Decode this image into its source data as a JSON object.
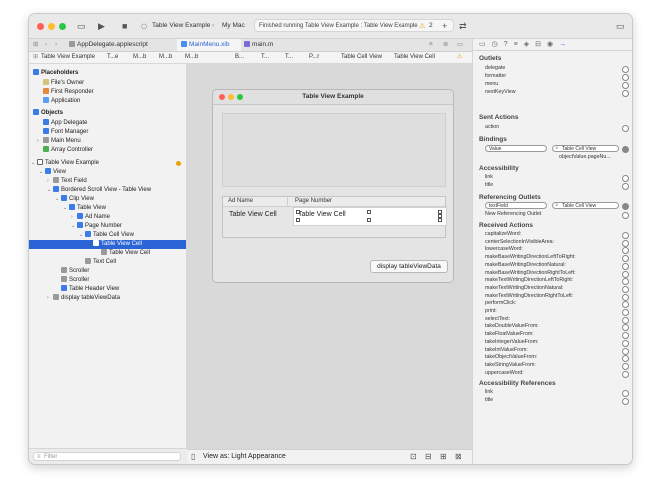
{
  "toolbar": {
    "scheme_target": "Table View Example",
    "scheme_device": "My Mac",
    "status": "Finished running Table View Example : Table View Example",
    "warning_count": "2"
  },
  "tabs": [
    {
      "label": "AppDelegate.applescript",
      "active": false
    },
    {
      "label": "MainMenu.xib",
      "active": true
    },
    {
      "label": "main.m",
      "active": false
    }
  ],
  "jumpbar": [
    "T...e)",
    "T...e",
    "M...b",
    "M...b",
    "B...",
    "T...",
    "T...",
    "P...r",
    "Table Cell View",
    "Table View Cell"
  ],
  "navigator": {
    "placeholders_title": "Placeholders",
    "placeholders": [
      "File's Owner",
      "First Responder",
      "Application"
    ],
    "objects_title": "Objects",
    "objects": [
      "App Delegate",
      "Font Manager",
      "Main Menu",
      "Array Controller"
    ],
    "window_title": "Table View Example",
    "tree": [
      {
        "label": "View",
        "indent": 1,
        "disclosure": "open"
      },
      {
        "label": "Text Field",
        "indent": 2,
        "disclosure": "closed"
      },
      {
        "label": "Bordered Scroll View - Table View",
        "indent": 2,
        "disclosure": "open"
      },
      {
        "label": "Clip View",
        "indent": 3,
        "disclosure": "open"
      },
      {
        "label": "Table View",
        "indent": 4,
        "disclosure": "open"
      },
      {
        "label": "Ad Name",
        "indent": 5,
        "disclosure": "closed"
      },
      {
        "label": "Page Number",
        "indent": 5,
        "disclosure": "open"
      },
      {
        "label": "Table Cell View",
        "indent": 6,
        "disclosure": "open"
      },
      {
        "label": "Table View Cell",
        "indent": 7,
        "disclosure": "open",
        "selected": true
      },
      {
        "label": "Table View Cell",
        "indent": 8,
        "disclosure": "none"
      },
      {
        "label": "Text Cell",
        "indent": 6,
        "disclosure": "none"
      },
      {
        "label": "Scroller",
        "indent": 3,
        "disclosure": "none"
      },
      {
        "label": "Scroller",
        "indent": 3,
        "disclosure": "none"
      },
      {
        "label": "Table Header View",
        "indent": 3,
        "disclosure": "none"
      },
      {
        "label": "display tableViewData",
        "indent": 2,
        "disclosure": "closed"
      }
    ],
    "filter_placeholder": "Filter"
  },
  "canvas": {
    "window_title": "Table View Example",
    "col1_header": "Ad Name",
    "col2_header": "Page Number",
    "cell1": "Table View Cell",
    "cell2": "Table View Cell",
    "button_label": "display tableViewData",
    "view_as": "View as: Light Appearance"
  },
  "inspector": {
    "outlets_title": "Outlets",
    "outlets": [
      "delegate",
      "formatter",
      "menu",
      "nextKeyView"
    ],
    "sent_actions_title": "Sent Actions",
    "sent_actions": [
      "action"
    ],
    "bindings_title": "Bindings",
    "binding_key": "Value",
    "binding_target": "Table Cell View",
    "binding_path": "objectValue.pageNu...",
    "accessibility_title": "Accessibility",
    "accessibility": [
      "link",
      "title"
    ],
    "ref_outlets_title": "Referencing Outlets",
    "ref_outlet_key": "textField",
    "ref_outlet_target": "Table Cell View",
    "new_ref_outlet": "New Referencing Outlet",
    "received_actions_title": "Received Actions",
    "received_actions": [
      "capitalizeWord:",
      "centerSelectionInVisibleArea:",
      "lowercaseWord:",
      "makeBaseWritingDirectionLeftToRight:",
      "makeBaseWritingDirectionNatural:",
      "makeBaseWritingDirectionRightToLeft:",
      "makeTextWritingDirectionLeftToRight:",
      "makeTextWritingDirectionNatural:",
      "makeTextWritingDirectionRightToLeft:",
      "performClick:",
      "print:",
      "selectText:",
      "takeDoubleValueFrom:",
      "takeFloatValueFrom:",
      "takeIntegerValueFrom:",
      "takeIntValueFrom:",
      "takeObjectValueFrom:",
      "takeStringValueFrom:",
      "uppercaseWord:"
    ],
    "acc_refs_title": "Accessibility References",
    "acc_refs": [
      "link",
      "title"
    ]
  },
  "colors": {
    "accent": "#2a64d6",
    "close": "#ff5f57",
    "minimize": "#febc2e",
    "zoom": "#28c840",
    "warning": "#e8a400"
  }
}
